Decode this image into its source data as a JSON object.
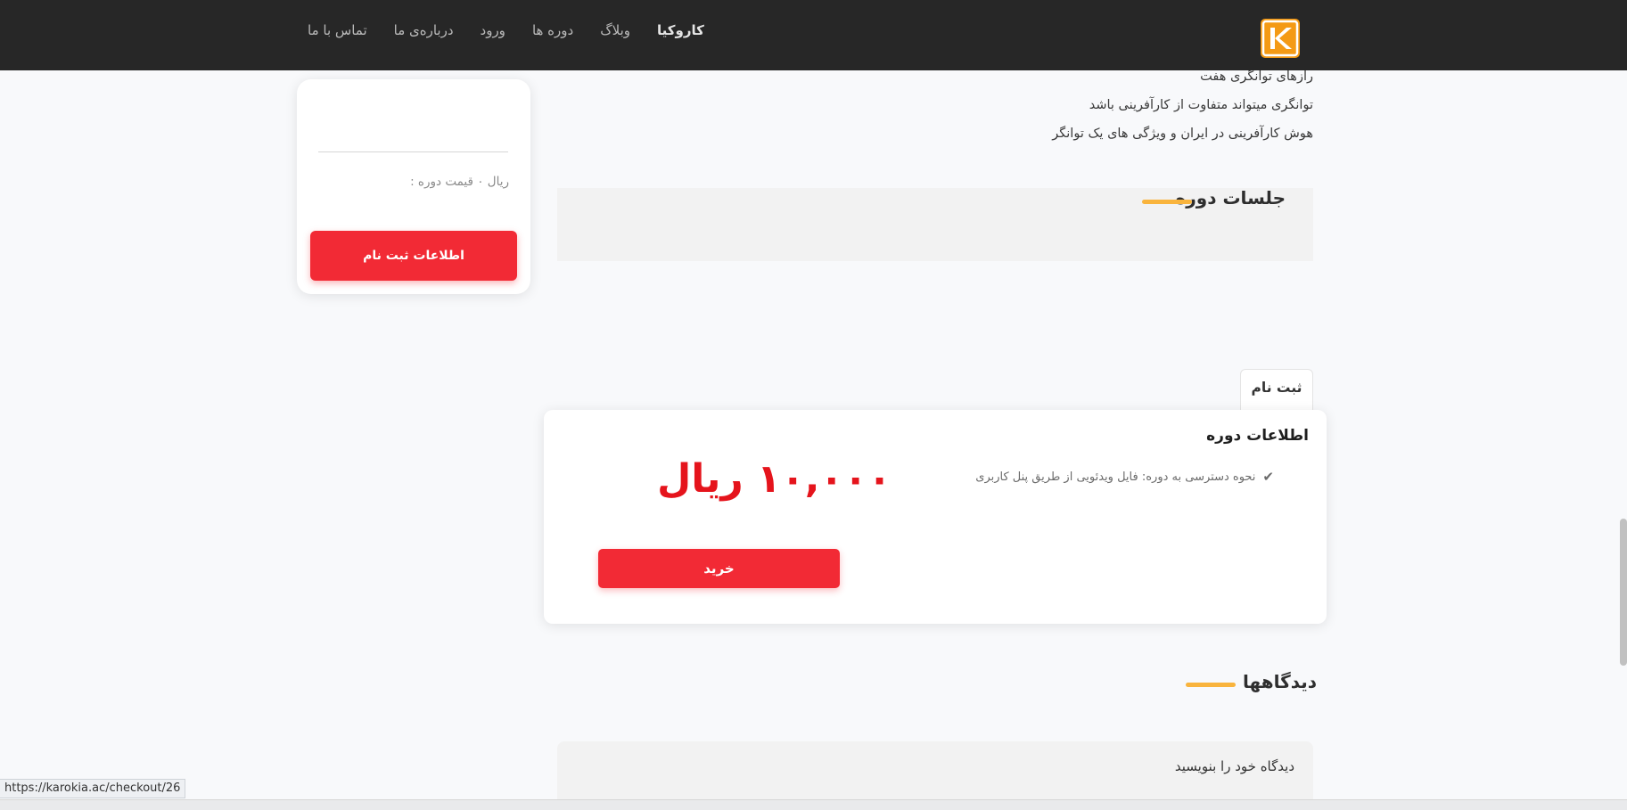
{
  "nav": {
    "brand": "کاروکیا",
    "items": [
      "وبلاگ",
      "دوره ها",
      "ورود",
      "درباره‌ی ما",
      "تماس با ما"
    ],
    "logo": "karokia-logo-icon"
  },
  "topics": [
    "رازهای توانگری هفت",
    "توانگری میتواند متفاوت از کارآفرینی باشد",
    "هوش کارآفرینی در ایران و ویژگی های یک توانگر"
  ],
  "sessions": {
    "title": "جلسات دوره"
  },
  "side_card": {
    "price_line": "ریال ۰ قیمت دوره :",
    "register_info_label": "اطلاعات ثبت نام"
  },
  "register_tab": "ثبت نام",
  "course_info": {
    "title": "اطلاعات دوره",
    "feature": "نحوه دسترسی به دوره: فایل ویدئویی از طریق پنل کاربری",
    "feature_icon": "check-icon",
    "price": "۱۰,۰۰۰ ریال",
    "buy_label": "خرید"
  },
  "comments": {
    "title": "دیدگاهها",
    "write_prompt": "دیدگاه خود را بنویسید"
  },
  "status_url": "https://karokia.ac/checkout/26",
  "colors": {
    "nav_bg": "#272727",
    "accent_red": "#f22a35",
    "price_red": "#e5141c",
    "title_bar_yellow": "#f9b43d",
    "logo_orange": "#f49a15"
  }
}
